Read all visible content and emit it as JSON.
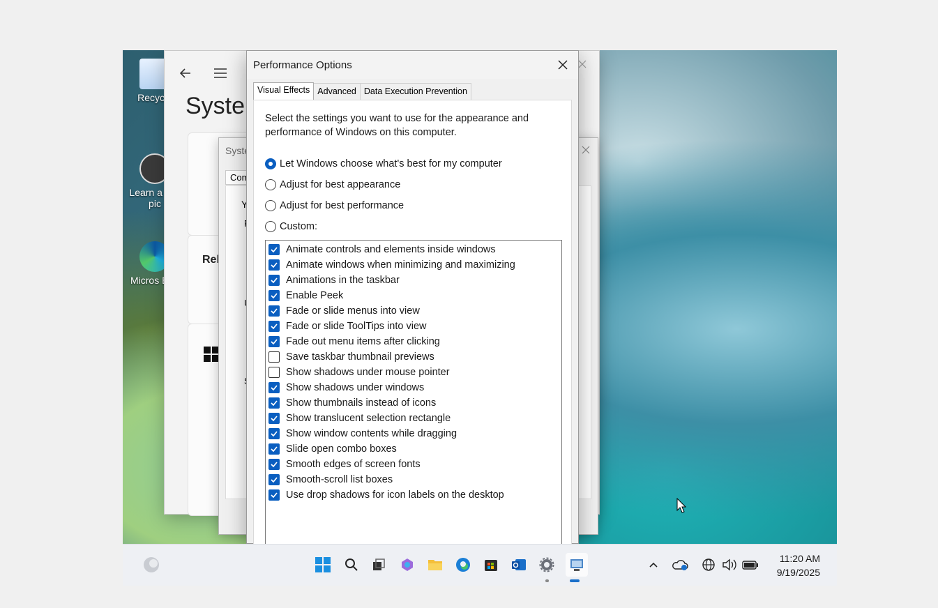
{
  "desktop": {
    "icons": [
      {
        "label": "Recycle"
      },
      {
        "label": "Learn a this pic"
      },
      {
        "label": "Micros Edg"
      }
    ]
  },
  "settings_window": {
    "title": "Syster",
    "card_label_1": "Rel",
    "sysprops_title": "Syste",
    "sysprops_tab": "Com",
    "sysprops_letters": [
      "Y",
      "P",
      "U",
      "S"
    ]
  },
  "dialog": {
    "title": "Performance Options",
    "tabs": [
      {
        "label": "Visual Effects",
        "active": true
      },
      {
        "label": "Advanced",
        "active": false
      },
      {
        "label": "Data Execution Prevention",
        "active": false
      }
    ],
    "description": "Select the settings you want to use for the appearance and performance of Windows on this computer.",
    "options": [
      {
        "label": "Let Windows choose what's best for my computer",
        "selected": true
      },
      {
        "label": "Adjust for best appearance",
        "selected": false
      },
      {
        "label": "Adjust for best performance",
        "selected": false
      },
      {
        "label": "Custom:",
        "selected": false
      }
    ],
    "effects": [
      {
        "label": "Animate controls and elements inside windows",
        "checked": true
      },
      {
        "label": "Animate windows when minimizing and maximizing",
        "checked": true
      },
      {
        "label": "Animations in the taskbar",
        "checked": true
      },
      {
        "label": "Enable Peek",
        "checked": true
      },
      {
        "label": "Fade or slide menus into view",
        "checked": true
      },
      {
        "label": "Fade or slide ToolTips into view",
        "checked": true
      },
      {
        "label": "Fade out menu items after clicking",
        "checked": true
      },
      {
        "label": "Save taskbar thumbnail previews",
        "checked": false
      },
      {
        "label": "Show shadows under mouse pointer",
        "checked": false
      },
      {
        "label": "Show shadows under windows",
        "checked": true
      },
      {
        "label": "Show thumbnails instead of icons",
        "checked": true
      },
      {
        "label": "Show translucent selection rectangle",
        "checked": true
      },
      {
        "label": "Show window contents while dragging",
        "checked": true
      },
      {
        "label": "Slide open combo boxes",
        "checked": true
      },
      {
        "label": "Smooth edges of screen fonts",
        "checked": true
      },
      {
        "label": "Smooth-scroll list boxes",
        "checked": true
      },
      {
        "label": "Use drop shadows for icon labels on the desktop",
        "checked": true
      }
    ]
  },
  "taskbar": {
    "time": "11:20 AM",
    "date": "9/19/2025",
    "apps": [
      "start-icon",
      "search-icon",
      "task-view-icon",
      "copilot-icon",
      "file-explorer-icon",
      "edge-icon",
      "store-icon",
      "outlook-icon",
      "settings-icon",
      "system-properties-icon"
    ],
    "tray": [
      "chevron-up-icon",
      "onedrive-icon",
      "network-icon",
      "volume-icon",
      "battery-icon"
    ]
  },
  "colors": {
    "accent": "#0a5ec0",
    "dialog_bg": "#f0f0f0",
    "taskbar_bg": "#eef0f4"
  }
}
